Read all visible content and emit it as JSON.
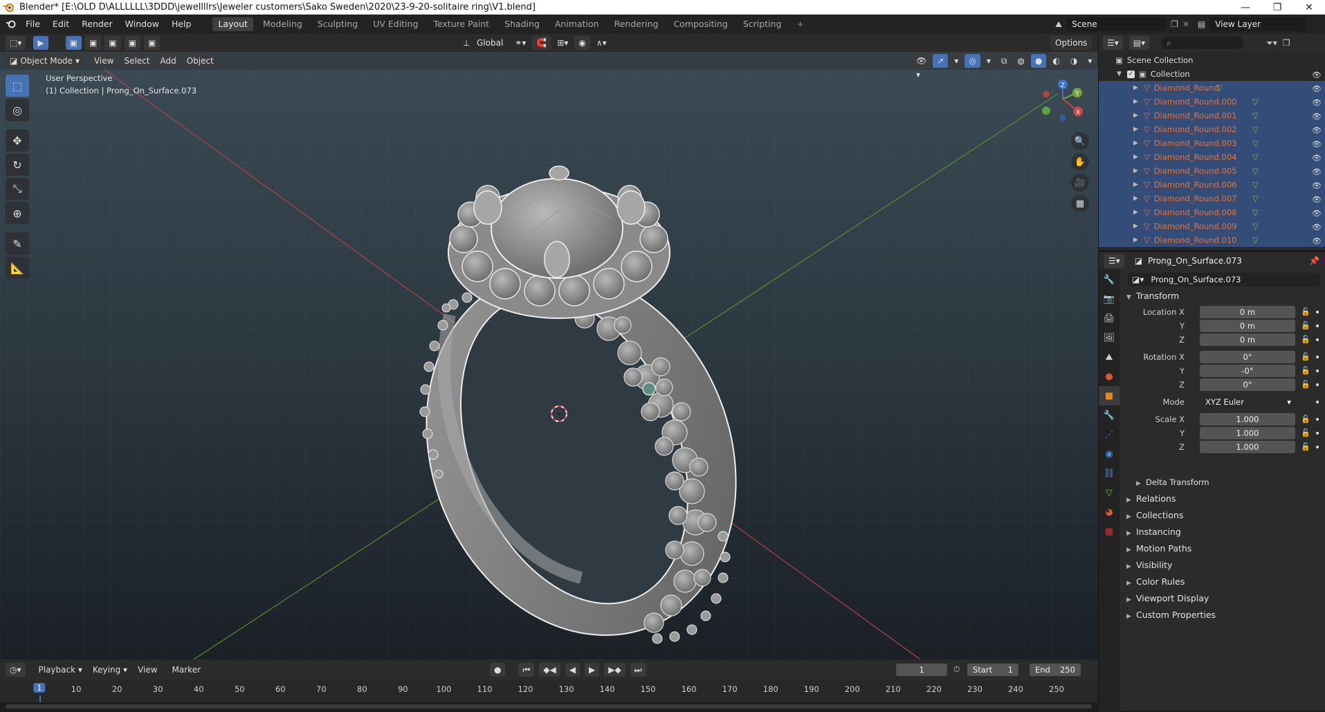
{
  "window": {
    "title": "Blender* [E:\\OLD D\\ALLLLLL\\3DDD\\jewellllrs\\Jeweler customers\\Sako Sweden\\2020\\23-9-20-solitaire ring\\V1.blend]",
    "minimize": "—",
    "maximize": "❐",
    "close": "✕"
  },
  "menu": [
    "File",
    "Edit",
    "Render",
    "Window",
    "Help"
  ],
  "workspaces": [
    {
      "label": "Layout",
      "active": true
    },
    {
      "label": "Modeling",
      "active": false
    },
    {
      "label": "Sculpting",
      "active": false
    },
    {
      "label": "UV Editing",
      "active": false
    },
    {
      "label": "Texture Paint",
      "active": false
    },
    {
      "label": "Shading",
      "active": false
    },
    {
      "label": "Animation",
      "active": false
    },
    {
      "label": "Rendering",
      "active": false
    },
    {
      "label": "Compositing",
      "active": false
    },
    {
      "label": "Scripting",
      "active": false
    }
  ],
  "add_workspace": "+",
  "scene": {
    "label": "Scene",
    "view_layer": "View Layer"
  },
  "viewport": {
    "transform_orientation": "Global",
    "options_label": "Options",
    "mode_label": "Object Mode",
    "header_menus": [
      "View",
      "Select",
      "Add",
      "Object"
    ],
    "perspective_label": "User Perspective",
    "collection_label": "(1) Collection | Prong_On_Surface.073",
    "gizmo_axes": {
      "x": "X",
      "y": "Y",
      "z": "Z"
    }
  },
  "outliner": {
    "scene_collection": "Scene Collection",
    "collection": "Collection",
    "items": [
      "Diamond_Round",
      "Diamond_Round.000",
      "Diamond_Round.001",
      "Diamond_Round.002",
      "Diamond_Round.003",
      "Diamond_Round.004",
      "Diamond_Round.005",
      "Diamond_Round.006",
      "Diamond_Round.007",
      "Diamond_Round.008",
      "Diamond_Round.009",
      "Diamond_Round.010"
    ]
  },
  "properties": {
    "object_name": "Prong_On_Surface.073",
    "data_name": "Prong_On_Surface.073",
    "transform_title": "Transform",
    "location": {
      "label_x": "Location X",
      "label_y": "Y",
      "label_z": "Z",
      "x": "0 m",
      "y": "0 m",
      "z": "0 m"
    },
    "rotation": {
      "label_x": "Rotation X",
      "label_y": "Y",
      "label_z": "Z",
      "x": "0°",
      "y": "-0°",
      "z": "0°"
    },
    "mode": {
      "label": "Mode",
      "value": "XYZ Euler"
    },
    "scale": {
      "label_x": "Scale X",
      "label_y": "Y",
      "label_z": "Z",
      "x": "1.000",
      "y": "1.000",
      "z": "1.000"
    },
    "delta_transform": "Delta Transform",
    "panels": [
      "Relations",
      "Collections",
      "Instancing",
      "Motion Paths",
      "Visibility",
      "Color Rules",
      "Viewport Display",
      "Custom Properties"
    ]
  },
  "timeline": {
    "menus": [
      "Playback",
      "Keying",
      "View",
      "Marker"
    ],
    "current_frame": "1",
    "start_label": "Start",
    "start": "1",
    "end_label": "End",
    "end": "250",
    "ticks": [
      "1",
      "10",
      "20",
      "30",
      "40",
      "50",
      "60",
      "70",
      "80",
      "90",
      "100",
      "110",
      "120",
      "130",
      "140",
      "150",
      "160",
      "170",
      "180",
      "190",
      "200",
      "210",
      "220",
      "230",
      "240",
      "250"
    ]
  },
  "colors": {
    "accent": "#4772b3",
    "selected_item_text": "#e6733a",
    "outliner_selection": "#334c78",
    "axis_x": "#c84848",
    "axis_y": "#5c9a3a",
    "mesh": "#8c8c8c"
  }
}
